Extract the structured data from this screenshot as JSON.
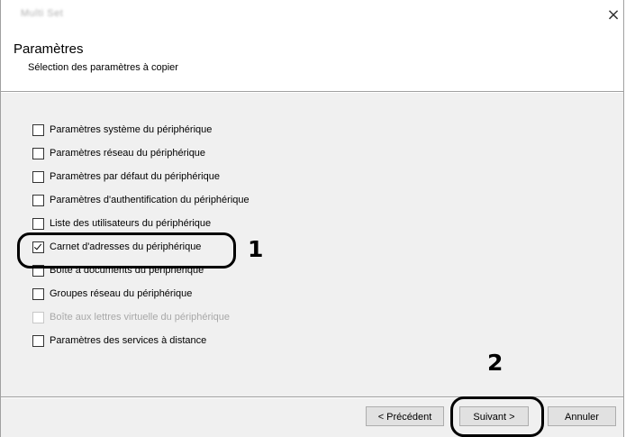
{
  "window": {
    "title": "Multi Set",
    "close_glyph": "×"
  },
  "header": {
    "title": "Paramètres",
    "subtitle": "Sélection des paramètres à copier"
  },
  "options": [
    {
      "label": "Paramètres système du périphérique",
      "checked": false,
      "disabled": false
    },
    {
      "label": "Paramètres réseau du périphérique",
      "checked": false,
      "disabled": false
    },
    {
      "label": "Paramètres par défaut du périphérique",
      "checked": false,
      "disabled": false
    },
    {
      "label": "Paramètres d'authentification du périphérique",
      "checked": false,
      "disabled": false
    },
    {
      "label": "Liste des utilisateurs du périphérique",
      "checked": false,
      "disabled": false
    },
    {
      "label": "Carnet d'adresses du périphérique",
      "checked": true,
      "disabled": false
    },
    {
      "label": "Boîte à documents du périphérique",
      "checked": false,
      "disabled": false
    },
    {
      "label": "Groupes réseau du périphérique",
      "checked": false,
      "disabled": false
    },
    {
      "label": "Boîte aux lettres virtuelle du périphérique",
      "checked": false,
      "disabled": true
    },
    {
      "label": "Paramètres des services à distance",
      "checked": false,
      "disabled": false
    }
  ],
  "buttons": {
    "prev_label": "< Précédent",
    "next_label": "Suivant >",
    "cancel_label": "Annuler"
  },
  "callouts": {
    "one": "1",
    "two": "2"
  }
}
